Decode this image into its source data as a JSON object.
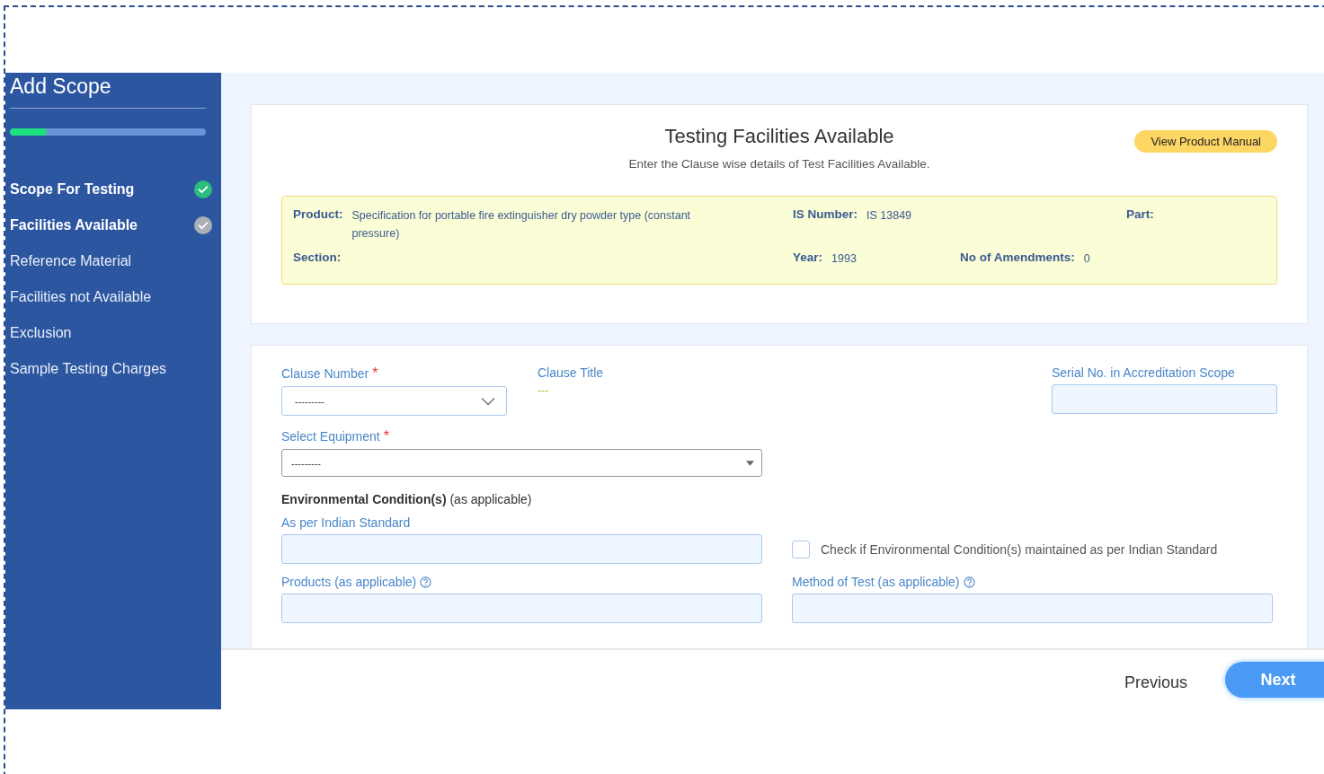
{
  "sidebar": {
    "title": "Add Scope",
    "progress": {
      "level": 0.19
    },
    "steps": [
      {
        "label": "Scope For Testing",
        "kind": "done"
      },
      {
        "label": "Facilities Available",
        "kind": "current"
      },
      {
        "label": "Reference Material",
        "kind": "pending"
      },
      {
        "label": "Facilities not Available",
        "kind": "pending"
      },
      {
        "label": "Exclusion",
        "kind": "pending"
      },
      {
        "label": "Sample Testing Charges",
        "kind": "pending"
      }
    ]
  },
  "header": {
    "title": "Testing Facilities Available",
    "subtitle": "Enter the Clause wise details of Test Facilities Available.",
    "manual_button": "View Product Manual"
  },
  "product_info": [
    [
      {
        "label": "Product:",
        "value": "Specification for portable fire extinguisher dry powder type (constant pressure)"
      },
      {
        "label": "IS Number:",
        "value": "IS 13849"
      },
      {
        "label": "Part:"
      }
    ],
    [
      {
        "label": "Section:"
      },
      {
        "label": "Year:",
        "value": "1993"
      },
      {
        "label": "No of Amendments:",
        "value": "0"
      }
    ]
  ],
  "form": {
    "clause_number": {
      "label": "Clause Number",
      "required_mark": "*",
      "value": "---------"
    },
    "clause_title": {
      "label": "Clause Title",
      "value": "---"
    },
    "serial_no": {
      "label": "Serial No. in Accreditation Scope"
    },
    "equipment": {
      "label": "Select Equipment",
      "required_mark": "*",
      "value": "---------"
    },
    "env_heading": "**Environmental Condition(s)** (as applicable)",
    "indian_standard": {
      "label": "As per Indian Standard"
    },
    "env_check": {
      "label": "Check if Environmental Condition(s) maintained as per Indian Standard",
      "checked": false
    },
    "products": {
      "label": "Products (as applicable)",
      "help": true
    },
    "method": {
      "label": "Method of Test (as applicable)",
      "help": true
    }
  },
  "footer": {
    "previous": "Previous",
    "next": "Next"
  }
}
